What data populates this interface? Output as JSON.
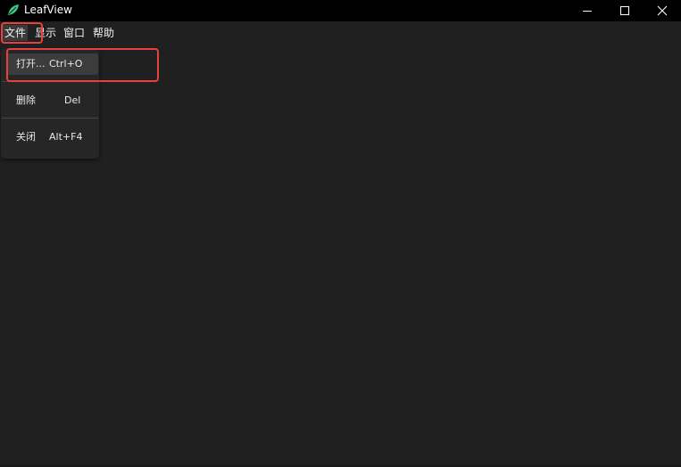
{
  "window": {
    "title": "LeafView",
    "controls": {
      "minimize": "minimize-icon",
      "maximize": "maximize-icon",
      "close": "close-icon"
    }
  },
  "menubar": {
    "items": [
      {
        "label": "文件",
        "active": true
      },
      {
        "label": "显示"
      },
      {
        "label": "窗口"
      },
      {
        "label": "帮助"
      }
    ]
  },
  "file_menu": {
    "items": [
      {
        "label": "打开...",
        "shortcut": "Ctrl+O",
        "highlighted": true
      },
      {
        "label": "删除",
        "shortcut": "Del"
      },
      {
        "label": "关闭",
        "shortcut": "Alt+F4"
      }
    ]
  },
  "colors": {
    "background": "#202020",
    "titlebar": "#000000",
    "menu_bg": "#262626",
    "hover_bg": "#3c3c3c",
    "annotation": "#e8413d",
    "leaf_icon": "#3fc98a"
  }
}
